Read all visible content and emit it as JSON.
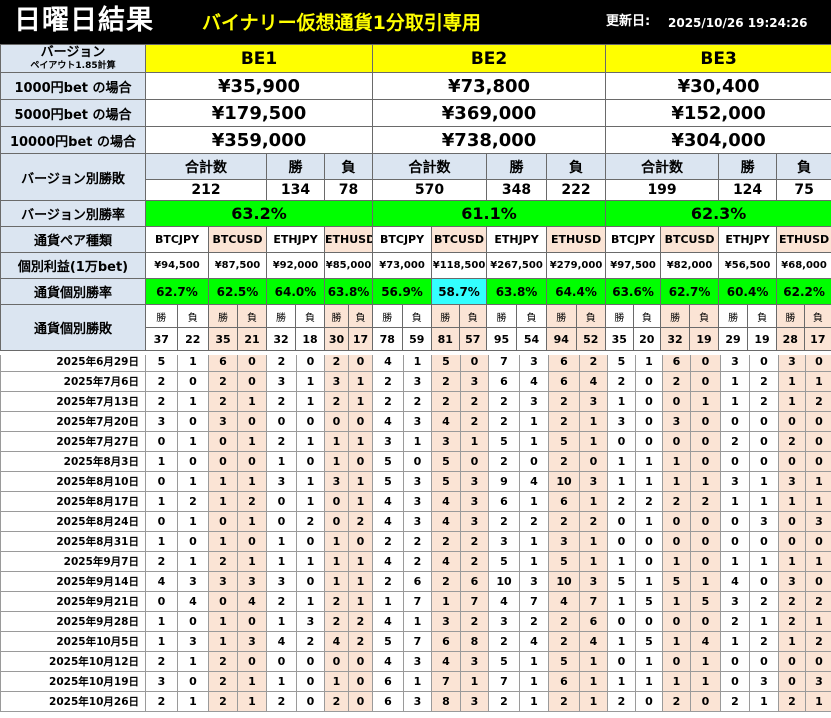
{
  "header": {
    "title": "日曜日結果",
    "subtitle": "バイナリー仮想通貨1分取引専用",
    "update_label": "更新日:",
    "update_value": "2025/10/26 19:24:26"
  },
  "summary": {
    "version_label": "バージョン",
    "payout_label": "ペイアウト1.85計算",
    "versions": [
      "BE1",
      "BE2",
      "BE3"
    ],
    "bet_rows": [
      {
        "label": "1000円bet の場合",
        "values": [
          "¥35,900",
          "¥73,800",
          "¥30,400"
        ]
      },
      {
        "label": "5000円bet の場合",
        "values": [
          "¥179,500",
          "¥369,000",
          "¥152,000"
        ]
      },
      {
        "label": "10000円bet の場合",
        "values": [
          "¥359,000",
          "¥738,000",
          "¥304,000"
        ]
      }
    ],
    "version_wl_label": "バージョン別勝敗",
    "total_label": "合計数",
    "win_label": "勝",
    "lose_label": "負",
    "version_wl": [
      {
        "total": "212",
        "win": "134",
        "lose": "78"
      },
      {
        "total": "570",
        "win": "348",
        "lose": "222"
      },
      {
        "total": "199",
        "win": "124",
        "lose": "75"
      }
    ],
    "version_rate_label": "バージョン別勝率",
    "version_rates": [
      "63.2%",
      "61.1%",
      "62.3%"
    ],
    "pair_type_label": "通貨ペア種類",
    "pairs": [
      "BTCJPY",
      "BTCUSD",
      "ETHJPY",
      "ETHUSD"
    ],
    "profit_label": "個別利益(1万bet)",
    "profits": [
      [
        "¥94,500",
        "¥87,500",
        "¥92,000",
        "¥85,000"
      ],
      [
        "¥73,000",
        "¥118,500",
        "¥267,500",
        "¥279,000"
      ],
      [
        "¥97,500",
        "¥82,000",
        "¥56,500",
        "¥68,000"
      ]
    ],
    "pair_rate_label": "通貨個別勝率",
    "pair_rates": [
      [
        "62.7%",
        "62.5%",
        "64.0%",
        "63.8%"
      ],
      [
        "56.9%",
        "58.7%",
        "63.8%",
        "64.4%"
      ],
      [
        "63.6%",
        "62.7%",
        "60.4%",
        "62.2%"
      ]
    ],
    "pair_wl_label": "通貨個別勝敗",
    "pair_wl": [
      [
        [
          "37",
          "22"
        ],
        [
          "35",
          "21"
        ],
        [
          "32",
          "18"
        ],
        [
          "30",
          "17"
        ]
      ],
      [
        [
          "78",
          "59"
        ],
        [
          "81",
          "57"
        ],
        [
          "95",
          "54"
        ],
        [
          "94",
          "52"
        ]
      ],
      [
        [
          "35",
          "20"
        ],
        [
          "32",
          "19"
        ],
        [
          "29",
          "19"
        ],
        [
          "28",
          "17"
        ]
      ]
    ]
  },
  "rows": [
    {
      "date": "2025年6月29日",
      "v": [
        "5",
        "1",
        "6",
        "0",
        "2",
        "0",
        "2",
        "0",
        "4",
        "1",
        "5",
        "0",
        "7",
        "3",
        "6",
        "2",
        "5",
        "1",
        "6",
        "0",
        "3",
        "0",
        "3",
        "0"
      ]
    },
    {
      "date": "2025年7月6日",
      "v": [
        "2",
        "0",
        "2",
        "0",
        "3",
        "1",
        "3",
        "1",
        "2",
        "3",
        "2",
        "3",
        "6",
        "4",
        "6",
        "4",
        "2",
        "0",
        "2",
        "0",
        "1",
        "2",
        "1",
        "1"
      ]
    },
    {
      "date": "2025年7月13日",
      "v": [
        "2",
        "1",
        "2",
        "1",
        "2",
        "1",
        "2",
        "1",
        "2",
        "2",
        "2",
        "2",
        "2",
        "3",
        "2",
        "3",
        "1",
        "0",
        "0",
        "1",
        "1",
        "2",
        "1",
        "2"
      ]
    },
    {
      "date": "2025年7月20日",
      "v": [
        "3",
        "0",
        "3",
        "0",
        "0",
        "0",
        "0",
        "0",
        "4",
        "3",
        "4",
        "2",
        "2",
        "1",
        "2",
        "1",
        "3",
        "0",
        "3",
        "0",
        "0",
        "0",
        "0",
        "0"
      ]
    },
    {
      "date": "2025年7月27日",
      "v": [
        "0",
        "1",
        "0",
        "1",
        "2",
        "1",
        "1",
        "1",
        "3",
        "1",
        "3",
        "1",
        "5",
        "1",
        "5",
        "1",
        "0",
        "0",
        "0",
        "0",
        "2",
        "0",
        "2",
        "0"
      ]
    },
    {
      "date": "2025年8月3日",
      "v": [
        "1",
        "0",
        "0",
        "0",
        "1",
        "0",
        "1",
        "0",
        "5",
        "0",
        "5",
        "0",
        "2",
        "0",
        "2",
        "0",
        "1",
        "1",
        "1",
        "0",
        "0",
        "0",
        "0",
        "0"
      ]
    },
    {
      "date": "2025年8月10日",
      "v": [
        "0",
        "1",
        "1",
        "1",
        "3",
        "1",
        "3",
        "1",
        "5",
        "3",
        "5",
        "3",
        "9",
        "4",
        "10",
        "3",
        "1",
        "1",
        "1",
        "1",
        "3",
        "1",
        "3",
        "1"
      ]
    },
    {
      "date": "2025年8月17日",
      "v": [
        "1",
        "2",
        "1",
        "2",
        "0",
        "1",
        "0",
        "1",
        "4",
        "3",
        "4",
        "3",
        "6",
        "1",
        "6",
        "1",
        "2",
        "2",
        "2",
        "2",
        "1",
        "1",
        "1",
        "1"
      ]
    },
    {
      "date": "2025年8月24日",
      "v": [
        "0",
        "1",
        "0",
        "1",
        "0",
        "2",
        "0",
        "2",
        "4",
        "3",
        "4",
        "3",
        "2",
        "2",
        "2",
        "2",
        "0",
        "1",
        "0",
        "0",
        "0",
        "3",
        "0",
        "3"
      ]
    },
    {
      "date": "2025年8月31日",
      "v": [
        "1",
        "0",
        "1",
        "0",
        "1",
        "0",
        "1",
        "0",
        "2",
        "2",
        "2",
        "2",
        "3",
        "1",
        "3",
        "1",
        "0",
        "0",
        "0",
        "0",
        "0",
        "0",
        "0",
        "0"
      ]
    },
    {
      "date": "2025年9月7日",
      "v": [
        "2",
        "1",
        "2",
        "1",
        "1",
        "1",
        "1",
        "1",
        "4",
        "2",
        "4",
        "2",
        "5",
        "1",
        "5",
        "1",
        "1",
        "0",
        "1",
        "0",
        "1",
        "1",
        "1",
        "1"
      ]
    },
    {
      "date": "2025年9月14日",
      "v": [
        "4",
        "3",
        "3",
        "3",
        "3",
        "0",
        "1",
        "1",
        "2",
        "6",
        "2",
        "6",
        "10",
        "3",
        "10",
        "3",
        "5",
        "1",
        "5",
        "1",
        "4",
        "0",
        "3",
        "0"
      ]
    },
    {
      "date": "2025年9月21日",
      "v": [
        "0",
        "4",
        "0",
        "4",
        "2",
        "1",
        "2",
        "1",
        "1",
        "7",
        "1",
        "7",
        "4",
        "7",
        "4",
        "7",
        "1",
        "5",
        "1",
        "5",
        "3",
        "2",
        "2",
        "2"
      ]
    },
    {
      "date": "2025年9月28日",
      "v": [
        "1",
        "0",
        "1",
        "0",
        "1",
        "3",
        "2",
        "2",
        "4",
        "1",
        "3",
        "2",
        "3",
        "2",
        "2",
        "6",
        "0",
        "0",
        "0",
        "0",
        "2",
        "1",
        "2",
        "1"
      ]
    },
    {
      "date": "2025年10月5日",
      "v": [
        "1",
        "3",
        "1",
        "3",
        "4",
        "2",
        "4",
        "2",
        "5",
        "7",
        "6",
        "8",
        "2",
        "4",
        "2",
        "4",
        "1",
        "5",
        "1",
        "4",
        "1",
        "2",
        "1",
        "2"
      ]
    },
    {
      "date": "2025年10月12日",
      "v": [
        "2",
        "1",
        "2",
        "0",
        "0",
        "0",
        "0",
        "0",
        "4",
        "3",
        "4",
        "3",
        "5",
        "1",
        "5",
        "1",
        "0",
        "1",
        "0",
        "1",
        "0",
        "0",
        "0",
        "0"
      ]
    },
    {
      "date": "2025年10月19日",
      "v": [
        "3",
        "0",
        "2",
        "1",
        "1",
        "0",
        "1",
        "0",
        "6",
        "1",
        "7",
        "1",
        "7",
        "1",
        "6",
        "1",
        "1",
        "1",
        "1",
        "1",
        "0",
        "3",
        "0",
        "3"
      ]
    },
    {
      "date": "2025年10月26日",
      "v": [
        "2",
        "1",
        "2",
        "1",
        "2",
        "0",
        "2",
        "0",
        "6",
        "3",
        "8",
        "3",
        "2",
        "1",
        "2",
        "1",
        "2",
        "0",
        "2",
        "0",
        "2",
        "1",
        "2",
        "1"
      ]
    }
  ]
}
